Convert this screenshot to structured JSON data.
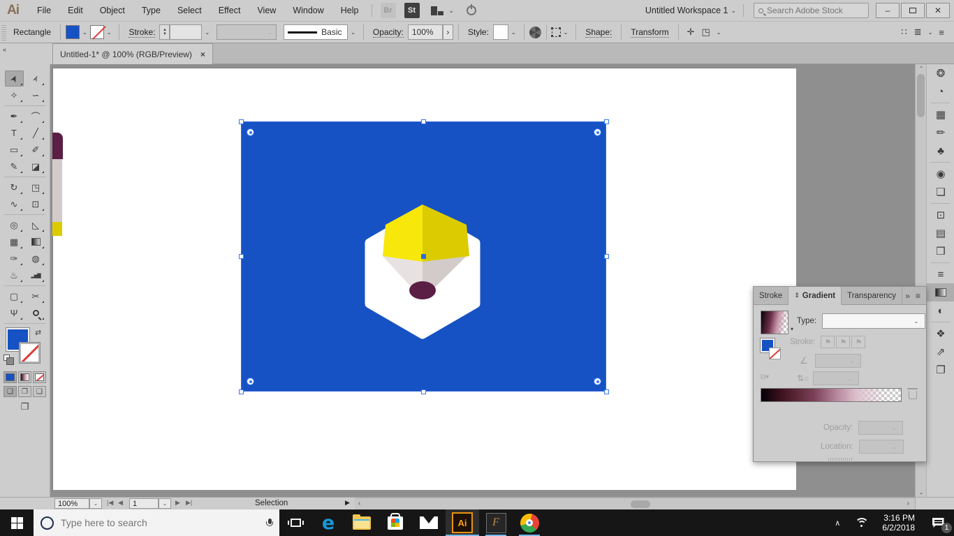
{
  "colors": {
    "artwork_blue": "#1652C4",
    "logo_yellow_left": "#F8E70A",
    "logo_yellow_right": "#DCCB00",
    "logo_gray_left": "#E7E2E1",
    "logo_gray_right": "#D2CBCA",
    "logo_purple": "#5B1E45",
    "selection_blue": "#2D6BE4",
    "fill_swatch_blue": "#1652C4",
    "taskbar_underline": "#76B9ED",
    "illustrator_orange": "#E8950C"
  },
  "menubar": {
    "app_logo": "Ai",
    "menus": [
      "File",
      "Edit",
      "Object",
      "Type",
      "Select",
      "Effect",
      "View",
      "Window",
      "Help"
    ],
    "bridge_badge": "Br",
    "stock_badge": "St",
    "workspace_name": "Untitled Workspace 1",
    "stock_search_placeholder": "Search Adobe Stock"
  },
  "control_bar": {
    "context_label": "Rectangle",
    "stroke_label": "Stroke:",
    "stroke_style_name": "Basic",
    "opacity_label": "Opacity:",
    "opacity_value": "100%",
    "style_label": "Style:",
    "shape_label": "Shape:",
    "transform_label": "Transform"
  },
  "document_tab": {
    "title": "Untitled-1* @ 100% (RGB/Preview)",
    "close_glyph": "×"
  },
  "tools": [
    "selection",
    "direct-selection",
    "magic-wand",
    "lasso",
    "pen",
    "curvature",
    "type",
    "line-segment",
    "rectangle",
    "paintbrush",
    "shaper",
    "eraser",
    "rotate",
    "scale",
    "width",
    "free-transform",
    "shape-builder",
    "perspective-grid",
    "mesh",
    "gradient",
    "eyedropper",
    "blend",
    "symbol-sprayer",
    "column-graph",
    "artboard",
    "slice",
    "hand",
    "zoom"
  ],
  "active_tool": "selection",
  "dock_panels": [
    "color",
    "color-guide",
    "swatches",
    "brushes",
    "symbols",
    "appearance",
    "graphic-styles",
    "transform",
    "align",
    "pathfinder",
    "stroke",
    "gradient",
    "transparency",
    "layers",
    "asset-export",
    "artboards"
  ],
  "dock_selected_panel": "gradient",
  "gradient_panel": {
    "tabs": [
      "Stroke",
      "Gradient",
      "Transparency"
    ],
    "active_tab": "Gradient",
    "type_label": "Type:",
    "stroke_label": "Stroke:",
    "opacity_label": "Opacity:",
    "location_label": "Location:"
  },
  "status_bar": {
    "zoom_level": "100%",
    "artboard_number": "1",
    "status_text": "Selection"
  },
  "taskbar": {
    "search_placeholder": "Type here to search",
    "apps": [
      {
        "name": "edge",
        "running": false,
        "active": false
      },
      {
        "name": "file-explorer",
        "running": false,
        "active": false
      },
      {
        "name": "store",
        "running": false,
        "active": false
      },
      {
        "name": "mail",
        "running": false,
        "active": false
      },
      {
        "name": "illustrator",
        "running": true,
        "active": true
      },
      {
        "name": "font-app",
        "running": true,
        "active": false
      },
      {
        "name": "chrome",
        "running": true,
        "active": false
      }
    ],
    "clock_time": "3:16 PM",
    "clock_date": "6/2/2018",
    "notification_badge": "1"
  }
}
